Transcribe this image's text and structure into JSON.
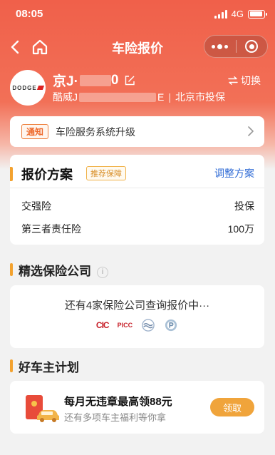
{
  "status_bar": {
    "time": "08:05",
    "network": "4G",
    "battery_level": 0.9
  },
  "nav": {
    "title": "车险报价"
  },
  "car": {
    "brand_logo_text": "DODGE",
    "plate_prefix": "京J·",
    "plate_suffix": "0",
    "model_prefix": "酷威J",
    "model_suffix": "E",
    "separator": "|",
    "city": "北京市投保",
    "switch_label": "切换"
  },
  "notice": {
    "tag": "通知",
    "text": "车险服务系统升级"
  },
  "plan": {
    "title": "报价方案",
    "recommend_tag": "推荐保障",
    "adjust_label": "调整方案",
    "rows": [
      {
        "name": "交强险",
        "value": "投保"
      },
      {
        "name": "第三者责任险",
        "value": "100万"
      }
    ]
  },
  "companies": {
    "title": "精选保险公司",
    "query_text": "还有4家保险公司查询报价中···",
    "logos": [
      "CIC",
      "PICC",
      "wave-logo",
      "p-logo"
    ]
  },
  "owner_plan": {
    "title": "好车主计划",
    "headline": "每月无违章最高领88元",
    "subtext": "还有多项车主福利等你拿",
    "button": "领取"
  },
  "colors": {
    "header": "#f0604a",
    "accent": "#f3a22f",
    "link": "#2f6bd6",
    "button": "#f0a43b"
  }
}
